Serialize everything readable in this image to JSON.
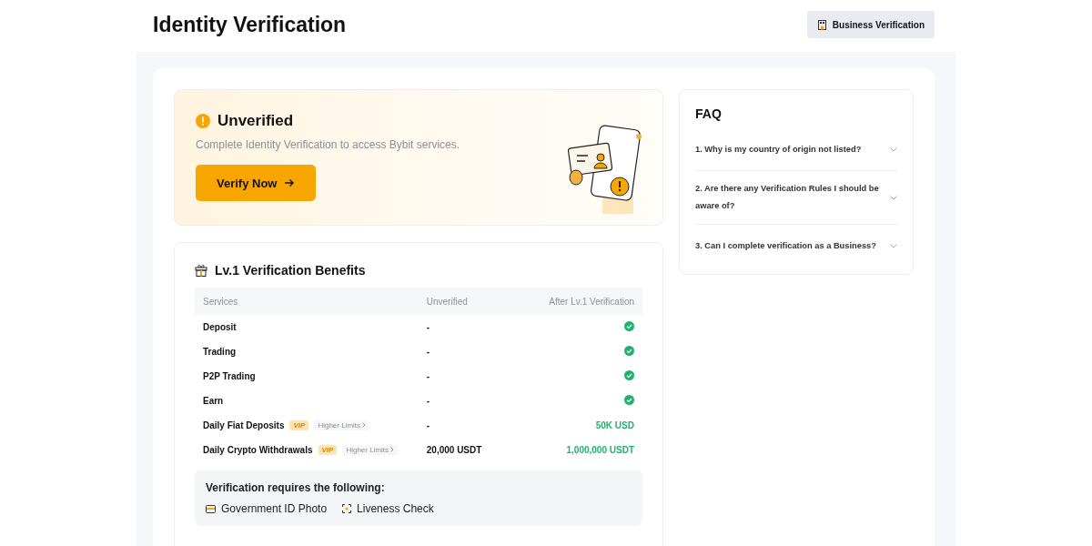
{
  "header": {
    "title": "Identity Verification",
    "button": "Business Verification"
  },
  "status": {
    "title": "Unverified",
    "description": "Complete Identity Verification to access Bybit services.",
    "button": "Verify Now"
  },
  "benefits": {
    "title": "Lv.1 Verification Benefits",
    "columns": [
      "Services",
      "Unverified",
      "After Lv.1 Verification"
    ],
    "rows": [
      {
        "service": "Deposit",
        "unverified": "-",
        "kind": "check"
      },
      {
        "service": "Trading",
        "unverified": "-",
        "kind": "check"
      },
      {
        "service": "P2P Trading",
        "unverified": "-",
        "kind": "check"
      },
      {
        "service": "Earn",
        "unverified": "-",
        "kind": "check"
      },
      {
        "service": "Daily Fiat Deposits",
        "badge": "VIP",
        "link": "Higher Limits",
        "unverified": "-",
        "kind": "text",
        "after": "50K USD"
      },
      {
        "service": "Daily Crypto Withdrawals",
        "badge": "VIP",
        "link": "Higher Limits",
        "unverified": "20,000 USDT",
        "kind": "text",
        "after": "1,000,000 USDT"
      }
    ],
    "requirements": {
      "title": "Verification requires the following:",
      "items": [
        {
          "kind": "id",
          "label": "Government ID Photo"
        },
        {
          "kind": "face",
          "label": "Liveness Check"
        }
      ]
    }
  },
  "faq": {
    "title": "FAQ",
    "items": [
      {
        "question": "1. Why is my country of origin not listed?",
        "expanded": false
      },
      {
        "question": "2. Are there any Verification Rules I should be aware of?",
        "expanded": false
      },
      {
        "question": "3. Can I complete verification as a Business?",
        "expanded": false
      }
    ]
  }
}
